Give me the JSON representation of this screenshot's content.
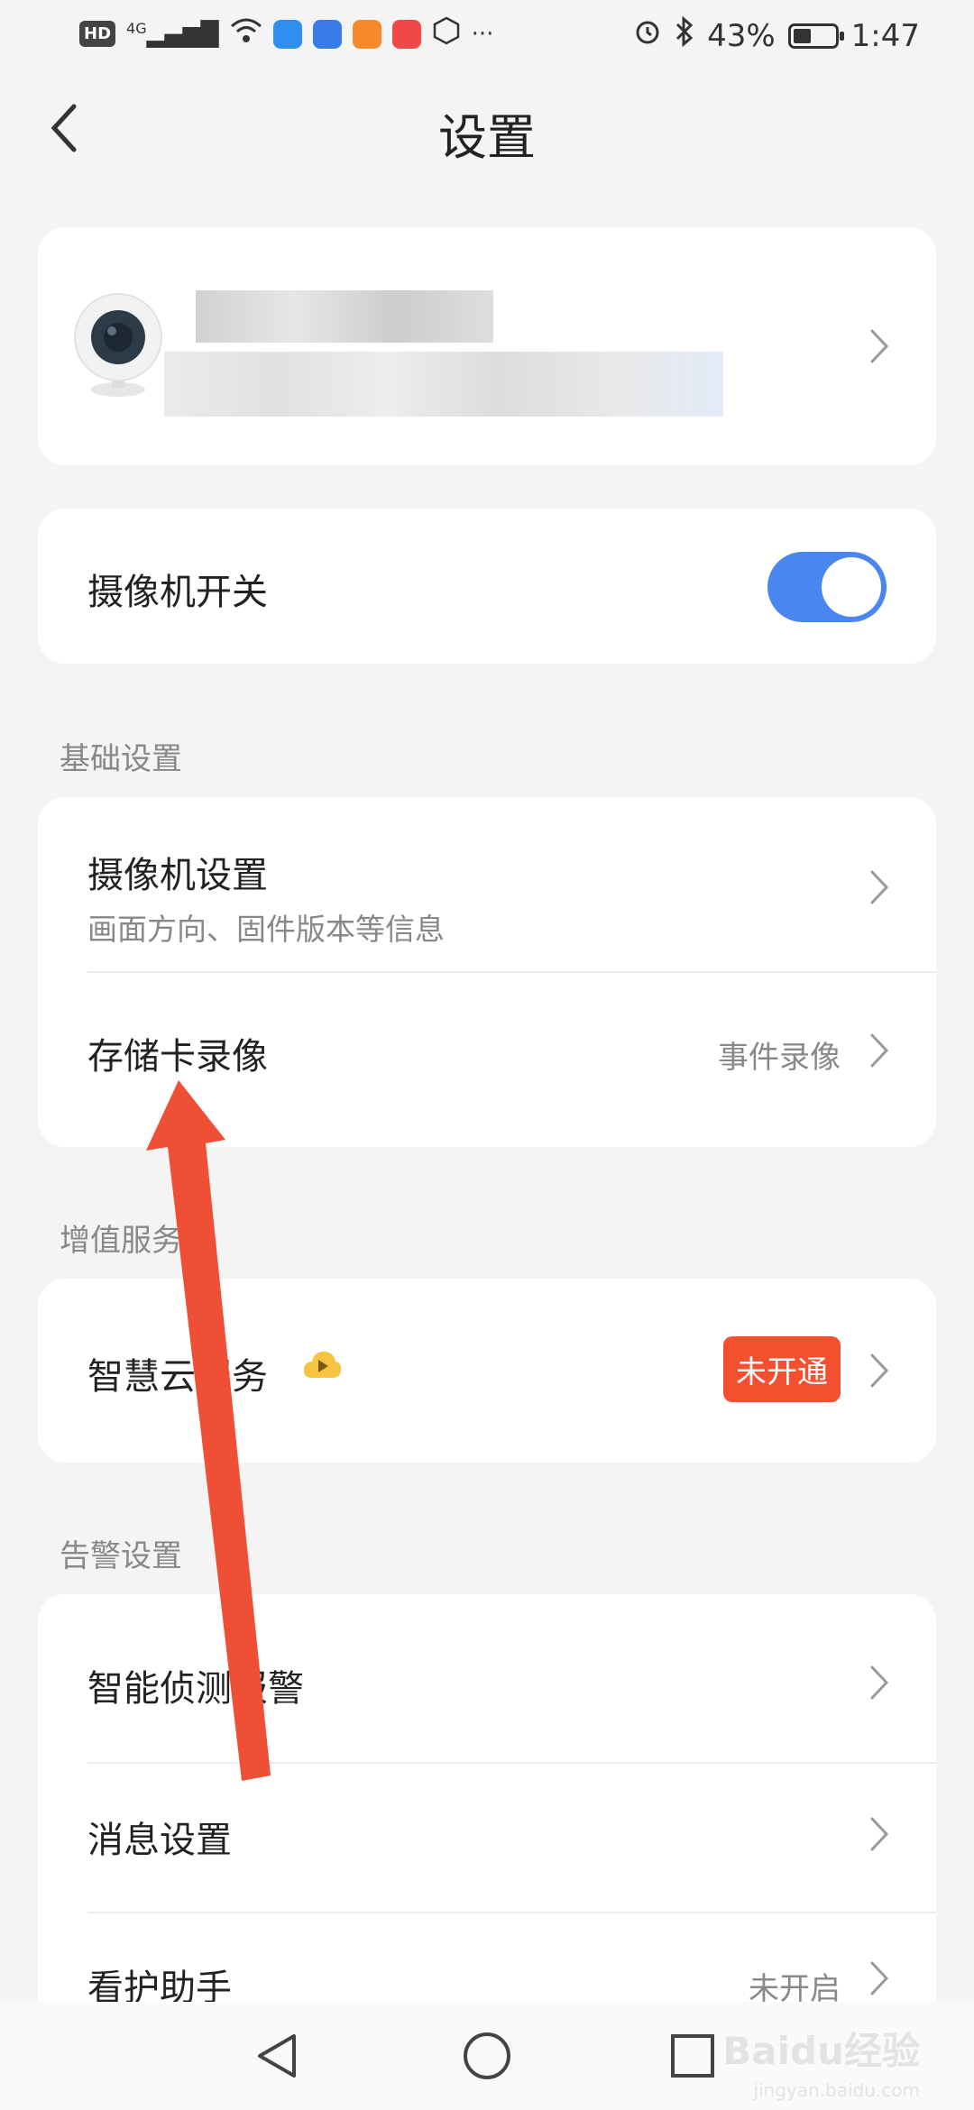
{
  "status_bar": {
    "hd": "HD",
    "network": "4G",
    "battery_text": "43%",
    "battery_level": 0.43,
    "time": "1:47",
    "more": "···"
  },
  "header": {
    "title": "设置",
    "back_icon": "chevron-left-icon"
  },
  "device_card": {
    "camera_icon": "camera-icon"
  },
  "camera_switch": {
    "label": "摄像机开关",
    "on": true,
    "accent": "#4a86f0"
  },
  "basic": {
    "section_title": "基础设置",
    "camera_settings": {
      "label": "摄像机设置",
      "sub": "画面方向、固件版本等信息"
    },
    "sd_recording": {
      "label": "存储卡录像",
      "value": "事件录像"
    }
  },
  "value_added": {
    "section_title": "增值服务",
    "cloud": {
      "label": "智慧云服务",
      "badge": "未开通",
      "badge_color": "#f4502f",
      "icon": "cloud-play-icon"
    }
  },
  "alerts": {
    "section_title": "告警设置",
    "smart_detect": {
      "label": "智能侦测报警"
    },
    "message_settings": {
      "label": "消息设置"
    },
    "care_assistant": {
      "label": "看护助手",
      "value": "未开启"
    }
  },
  "annotation": {
    "arrow_color": "#ef4f35"
  },
  "watermark": {
    "text": "Baidu经验",
    "sub": "jingyan.baidu.com"
  }
}
